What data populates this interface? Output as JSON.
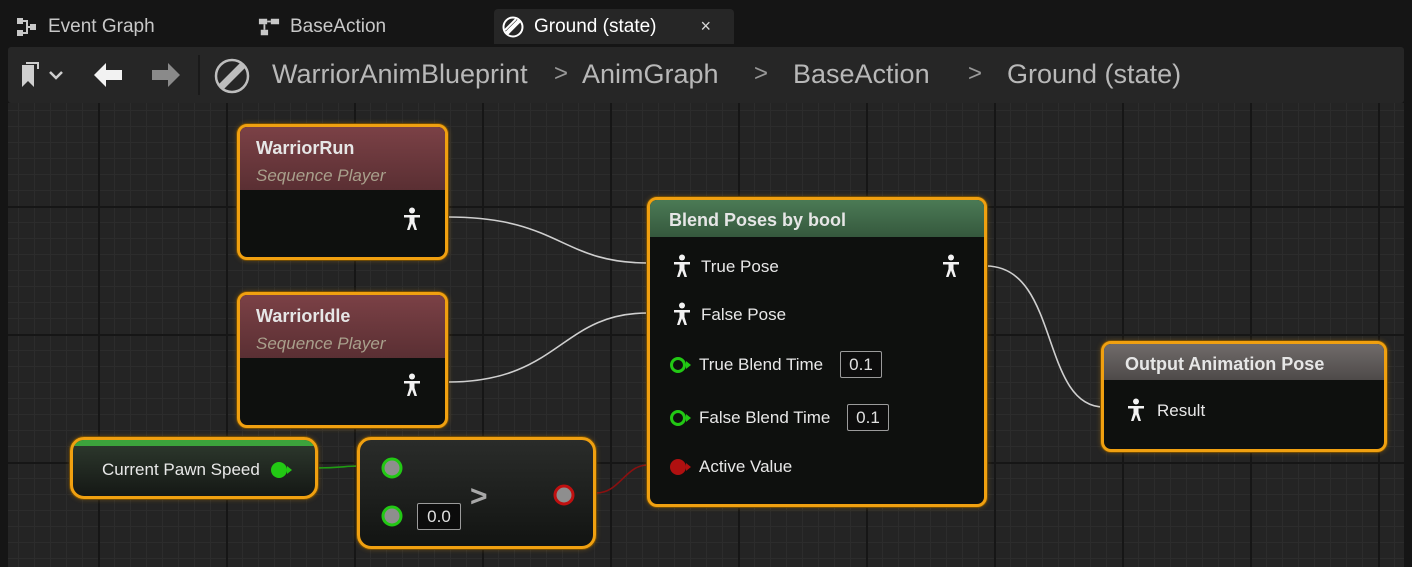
{
  "tabs": [
    {
      "label": "Event Graph",
      "icon": "event-graph-icon",
      "active": false
    },
    {
      "label": "BaseAction",
      "icon": "state-machine-icon",
      "active": false
    },
    {
      "label": "Ground (state)",
      "icon": "state-icon",
      "active": true,
      "close": "×"
    }
  ],
  "breadcrumbs": [
    "WarriorAnimBlueprint",
    "AnimGraph",
    "BaseAction",
    "Ground (state)"
  ],
  "separator": ">",
  "nodes": {
    "warrior_run": {
      "title": "WarriorRun",
      "subtitle": "Sequence Player"
    },
    "warrior_idle": {
      "title": "WarriorIdle",
      "subtitle": "Sequence Player"
    },
    "pawn_speed": {
      "label": "Current Pawn Speed"
    },
    "compare": {
      "operator": ">",
      "value": "0.0"
    },
    "blend": {
      "title": "Blend Poses by bool",
      "true_pose": "True Pose",
      "false_pose": "False Pose",
      "true_blend_time": "True Blend Time",
      "true_blend_value": "0.1",
      "false_blend_time": "False Blend Time",
      "false_blend_value": "0.1",
      "active_value": "Active Value"
    },
    "output": {
      "title": "Output Animation Pose",
      "result": "Result"
    }
  },
  "colors": {
    "node_border": "#f0a010",
    "sequence_header": "#7b4146",
    "blend_header": "#4b7a55",
    "output_header": "#706b6a",
    "float_pin": "#22c814",
    "bool_pin": "#b01010",
    "pose_wire": "#cfcfcf"
  }
}
